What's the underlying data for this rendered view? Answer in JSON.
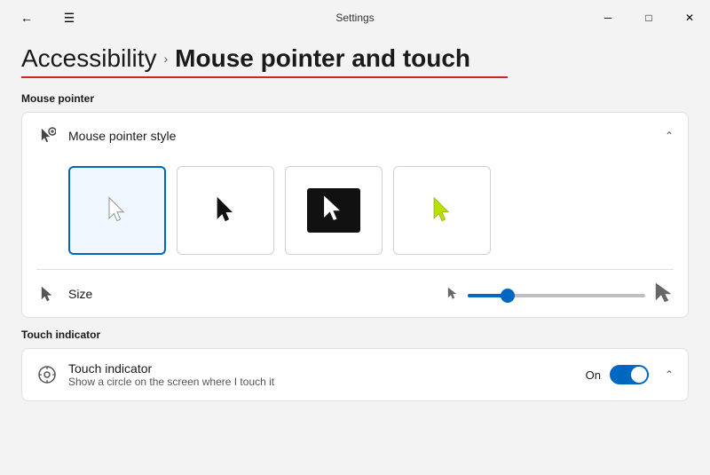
{
  "titleBar": {
    "title": "Settings",
    "minBtn": "─",
    "maxBtn": "□",
    "closeBtn": "✕"
  },
  "breadcrumb": {
    "parent": "Accessibility",
    "chevron": "›",
    "current": "Mouse pointer and touch"
  },
  "sections": {
    "mousePointer": {
      "label": "Mouse pointer",
      "pointerStyleCard": {
        "icon": "cursor-icon",
        "label": "Mouse pointer style",
        "options": [
          {
            "id": "white",
            "selected": true,
            "label": "white cursor"
          },
          {
            "id": "black",
            "selected": false,
            "label": "black cursor"
          },
          {
            "id": "inverted",
            "selected": false,
            "label": "inverted cursor"
          },
          {
            "id": "custom",
            "selected": false,
            "label": "custom cursor"
          }
        ]
      },
      "sizeCard": {
        "icon": "resize-cursor-icon",
        "label": "Size",
        "sliderValue": 20
      }
    },
    "touchIndicator": {
      "label": "Touch indicator",
      "card": {
        "icon": "touch-icon",
        "title": "Touch indicator",
        "subtitle": "Show a circle on the screen where I touch it",
        "status": "On",
        "expanded": true
      }
    }
  }
}
